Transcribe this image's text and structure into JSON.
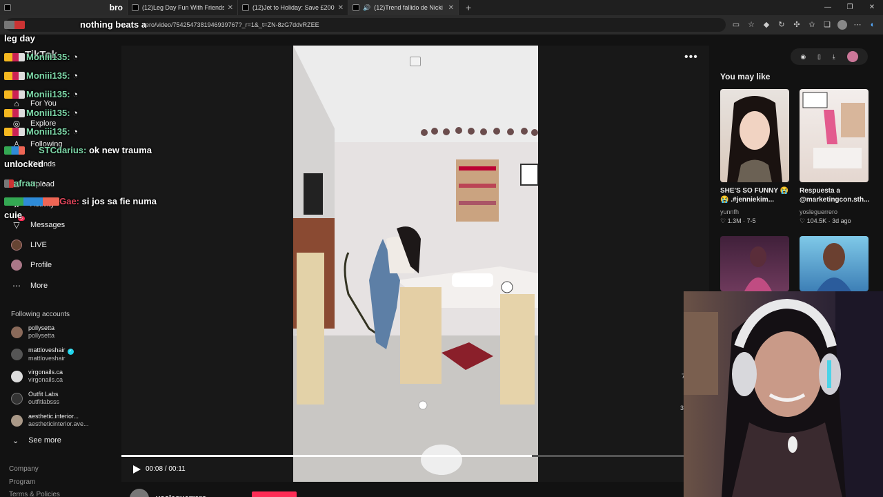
{
  "browser": {
    "tabs": [
      {
        "title": "bro"
      },
      {
        "title": "(12)Leg Day Fun With Friends: W"
      },
      {
        "title": "(12)Jet to Holiday: Save £200 for"
      },
      {
        "title": "(12)Trend fallido de Nicki M"
      }
    ],
    "new_tab": "+",
    "url": "rero/video/7542547381946939767?_r=1&_t=ZN-8zG7ddvRZEE",
    "window_controls": [
      "—",
      "❐",
      "✕"
    ]
  },
  "chat": {
    "messages": [
      {
        "user": "",
        "text": "nothing beats a"
      },
      {
        "user": "",
        "text": "leg day"
      },
      {
        "user": "Moniii135:",
        "text": ""
      },
      {
        "user": "Moniii135:",
        "text": ""
      },
      {
        "user": "Moniii135:",
        "text": ""
      },
      {
        "user": "Moniii135:",
        "text": ""
      },
      {
        "user": "Moniii135:",
        "text": ""
      },
      {
        "user": "STCdarius:",
        "text": "ok new trauma"
      },
      {
        "user": "",
        "text": "unlocked"
      },
      {
        "user": "afraa:",
        "text": ""
      },
      {
        "user": "wGae:",
        "text": "si jos sa fie numa"
      },
      {
        "user": "",
        "text": "cuie"
      }
    ]
  },
  "sidebar": {
    "logo": "TikTok",
    "items": [
      {
        "label": "For You",
        "icon": "home-icon"
      },
      {
        "label": "Explore",
        "icon": "compass-icon"
      },
      {
        "label": "Following",
        "icon": "user-icon"
      },
      {
        "label": "Friends",
        "icon": "users-icon"
      },
      {
        "label": "Upload",
        "icon": "plus-icon"
      },
      {
        "label": "Activity",
        "icon": "bell-icon"
      },
      {
        "label": "Messages",
        "icon": "send-icon",
        "badge": "5"
      },
      {
        "label": "LIVE",
        "icon": "live-icon"
      },
      {
        "label": "Profile",
        "icon": "profile-icon"
      },
      {
        "label": "More",
        "icon": "more-icon"
      }
    ],
    "following_header": "Following accounts",
    "accounts": [
      {
        "name": "pollysetta",
        "username": "pollysetta",
        "verified": false,
        "color": "#8a6a5a"
      },
      {
        "name": "mattloveshair",
        "username": "mattloveshair",
        "verified": true,
        "color": "#555"
      },
      {
        "name": "virgonails.ca",
        "username": "virgonails.ca",
        "verified": false,
        "color": "#ddd"
      },
      {
        "name": "Outfit Labs",
        "username": "outfitlabsss",
        "verified": false,
        "color": "#333"
      },
      {
        "name": "aesthetic.interior...",
        "username": "aestheticinterior.ave...",
        "verified": false,
        "color": "#a98"
      }
    ],
    "see_more": "See more",
    "footer": [
      "Company",
      "Program",
      "Terms & Policies"
    ]
  },
  "player": {
    "current_time": "00:08",
    "duration": "00:11",
    "time_separator": " / ",
    "progress_fraction": 0.73,
    "author": "yosleguerrero"
  },
  "right": {
    "you_may_like": "You may like",
    "cards": [
      {
        "title": "SHE'S SO FUNNY 😭😭 .#jenniekim...",
        "user": "yunnfh",
        "likes": "1.3M",
        "date": "7-5"
      },
      {
        "title": "Respuesta a @marketingcon.sth...",
        "user": "yosleguerrero",
        "likes": "104.5K",
        "date": "3d ago"
      },
      {
        "title": "",
        "user": "",
        "likes": "",
        "date": ""
      },
      {
        "title": "",
        "user": "",
        "likes": "",
        "date": ""
      }
    ],
    "side_numbers": [
      "7",
      "3"
    ]
  },
  "colors": {
    "accent": "#fe2c55",
    "background": "#121212",
    "chat_user": "#7dd8a8"
  }
}
